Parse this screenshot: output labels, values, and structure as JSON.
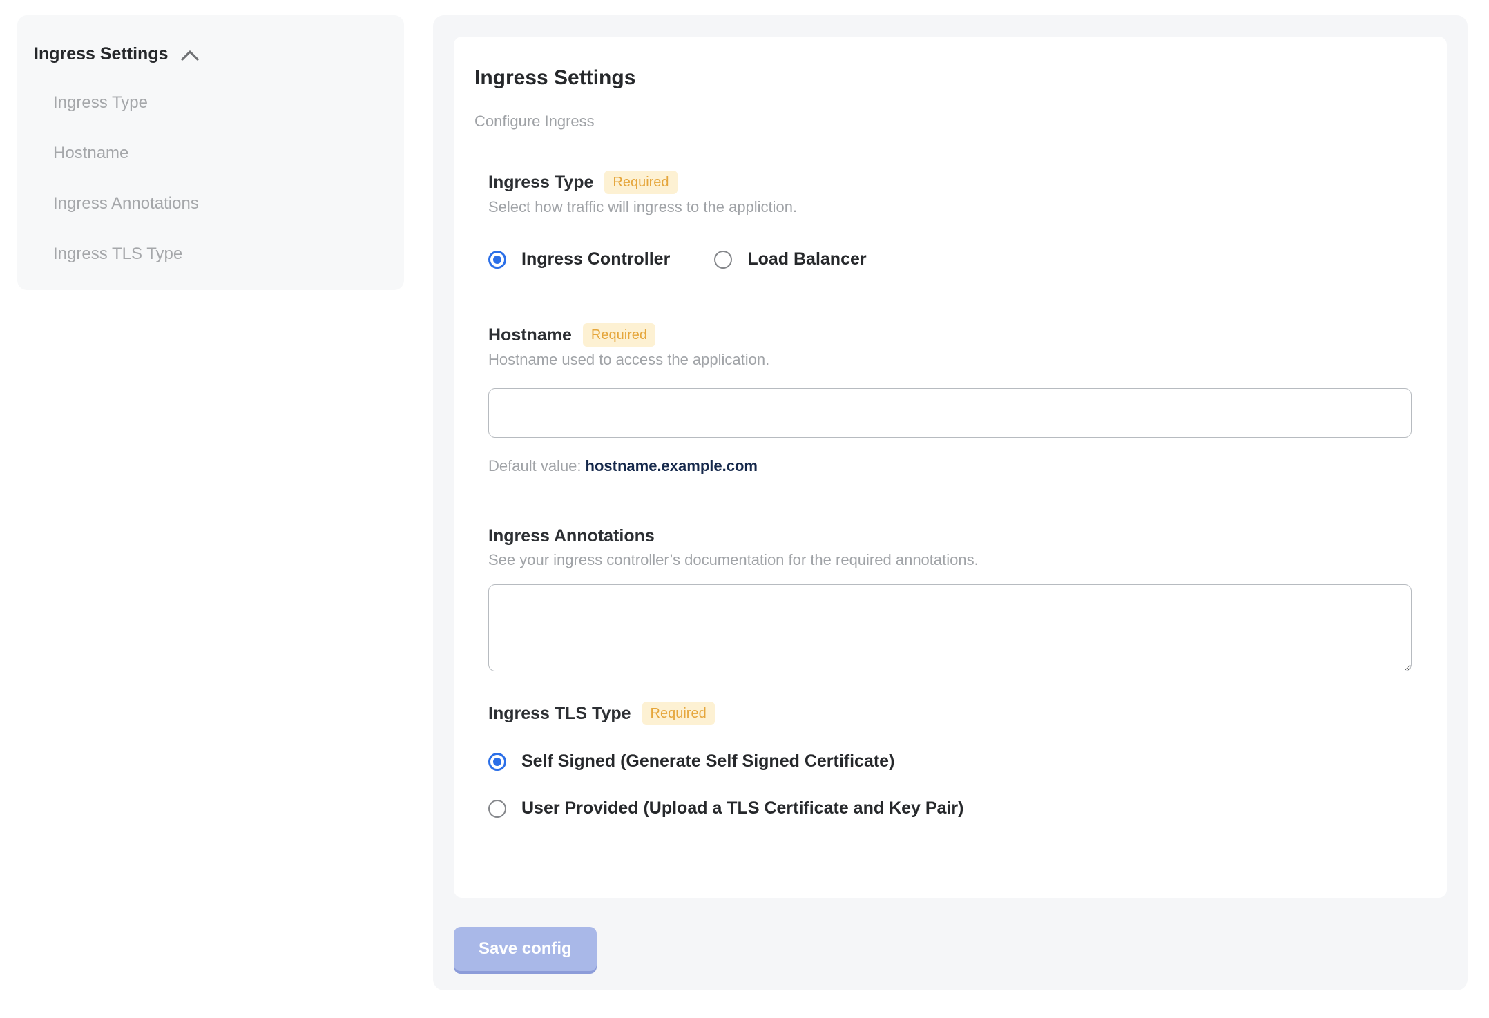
{
  "sidebar": {
    "header": "Ingress Settings",
    "items": [
      {
        "label": "Ingress Type"
      },
      {
        "label": "Hostname"
      },
      {
        "label": "Ingress Annotations"
      },
      {
        "label": "Ingress TLS Type"
      }
    ]
  },
  "main": {
    "title": "Ingress Settings",
    "subtitle": "Configure Ingress",
    "required_label": "Required",
    "fields": {
      "ingress_type": {
        "label": "Ingress Type",
        "required": true,
        "description": "Select how traffic will ingress to the appliction.",
        "options": [
          {
            "label": "Ingress Controller",
            "selected": true
          },
          {
            "label": "Load Balancer",
            "selected": false
          }
        ]
      },
      "hostname": {
        "label": "Hostname",
        "required": true,
        "description": "Hostname used to access the application.",
        "value": "",
        "default_prefix": "Default value:",
        "default_value": "hostname.example.com"
      },
      "annotations": {
        "label": "Ingress Annotations",
        "required": false,
        "description": "See your ingress controller’s documentation for the required annotations.",
        "value": ""
      },
      "tls_type": {
        "label": "Ingress TLS Type",
        "required": true,
        "options": [
          {
            "label": "Self Signed (Generate Self Signed Certificate)",
            "selected": true
          },
          {
            "label": "User Provided (Upload a TLS Certificate and Key Pair)",
            "selected": false
          }
        ]
      }
    },
    "save_button": "Save config"
  },
  "colors": {
    "accent_blue": "#2b6fe8",
    "badge_bg": "#fdf1d3",
    "badge_text": "#e5a63c",
    "button_bg": "#a9b8e8",
    "button_shadow": "#8c9cd9",
    "panel_gray": "#f5f6f8"
  }
}
